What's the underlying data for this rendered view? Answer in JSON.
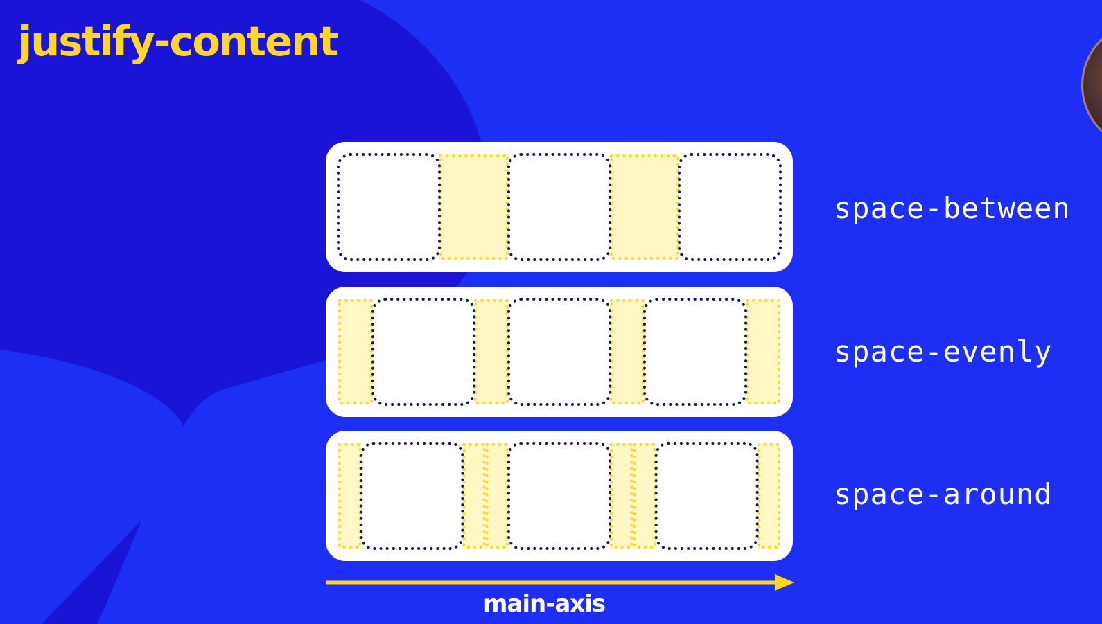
{
  "slide": {
    "title": "justify-content",
    "background_color": "#1e2ff5",
    "shape_color": "#1a14d6",
    "accent_color": "#ffd629",
    "box_border_color": "#14165e",
    "space_fill_color": "#fff7c4"
  },
  "rows": [
    {
      "label": "space-between",
      "value": "space-between",
      "items": 3
    },
    {
      "label": "space-evenly",
      "value": "space-evenly",
      "items": 3
    },
    {
      "label": "space-around",
      "value": "space-around",
      "items": 3
    }
  ],
  "axis": {
    "label": "main-axis",
    "direction": "left-to-right"
  },
  "presenter": {
    "icon": "presenter-webcam"
  }
}
